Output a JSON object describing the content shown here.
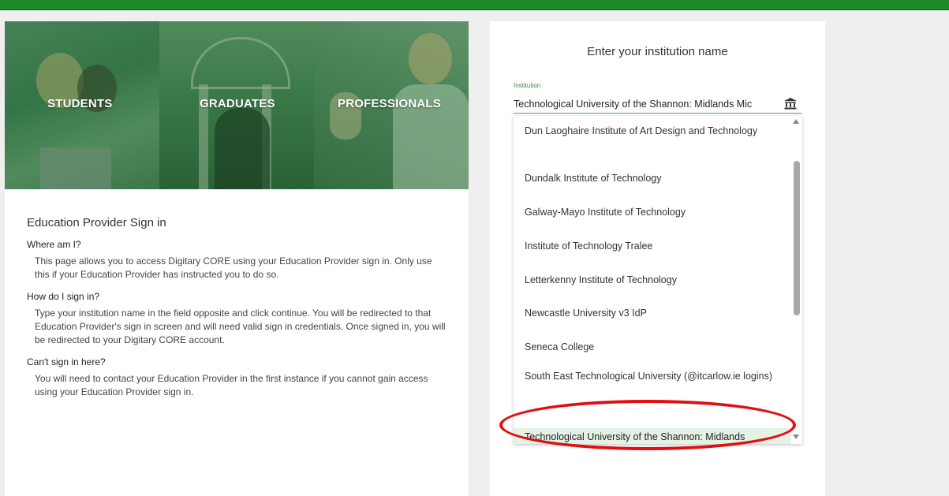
{
  "hero": {
    "tiles": [
      {
        "label": "STUDENTS"
      },
      {
        "label": "GRADUATES"
      },
      {
        "label": "PROFESSIONALS"
      }
    ]
  },
  "info": {
    "title": "Education Provider Sign in",
    "sections": [
      {
        "question": "Where am I?",
        "answer": "This page allows you to access Digitary CORE using your Education Provider sign in. Only use this if your Education Provider has instructed you to do so."
      },
      {
        "question": "How do I sign in?",
        "answer": "Type your institution name in the field opposite and click continue. You will be redirected to that Education Provider's sign in screen and will need valid sign in credentials. Once signed in, you will be redirected to your Digitary CORE account."
      },
      {
        "question": "Can't sign in here?",
        "answer": "You will need to contact your Education Provider in the first instance if you cannot gain access using your Education Provider sign in."
      }
    ]
  },
  "form": {
    "title": "Enter your institution name",
    "field_label": "Institution",
    "field_value": "Technological University of the Shannon: Midlands Mic",
    "icon": "institution-icon"
  },
  "dropdown": {
    "options": [
      {
        "label": "Dun Laoghaire Institute of Art Design and Technology"
      },
      {
        "label": "Dundalk Institute of Technology"
      },
      {
        "label": "Galway-Mayo Institute of Technology"
      },
      {
        "label": "Institute of Technology Tralee"
      },
      {
        "label": "Letterkenny Institute of Technology"
      },
      {
        "label": "Newcastle University v3 IdP"
      },
      {
        "label": "Seneca College"
      },
      {
        "label": "South East Technological University (@itcarlow.ie logins)"
      },
      {
        "label": "Technological University of the Shannon: Midlands Midwest"
      }
    ],
    "selected_index": 8
  },
  "colors": {
    "brand_green": "#1f8a2a",
    "highlight_ring": "#e01010",
    "selected_bg": "#e6f2e6"
  }
}
